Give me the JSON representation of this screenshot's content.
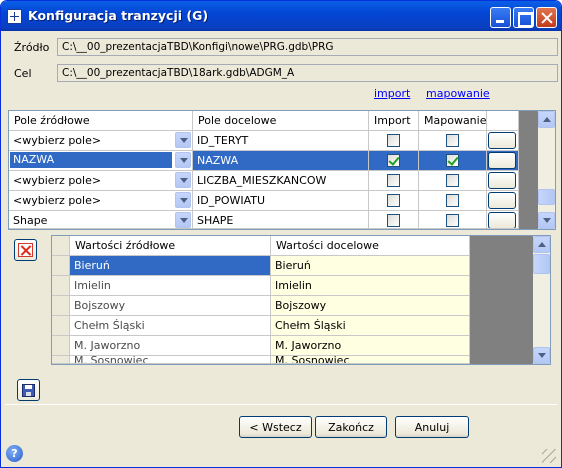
{
  "window": {
    "title": "Konfiguracja tranzycji (G)"
  },
  "source": {
    "label": "Źródło",
    "value": "C:\\__00_prezentacjaTBD\\Konfigi\\nowe\\PRG.gdb\\PRG"
  },
  "target": {
    "label": "Cel",
    "value": "C:\\__00_prezentacjaTBD\\18ark.gdb\\ADGM_A"
  },
  "links": {
    "import": "import",
    "mapping": "mapowanie"
  },
  "fields_grid": {
    "headers": [
      "Pole źródłowe",
      "Pole docelowe",
      "Import",
      "Mapowanie"
    ],
    "rows": [
      {
        "source": "<wybierz pole>",
        "target": "ID_TERYT",
        "import": false,
        "mapping": false,
        "selected": false
      },
      {
        "source": "NAZWA",
        "target": "NAZWA",
        "import": true,
        "mapping": true,
        "selected": true
      },
      {
        "source": "<wybierz pole>",
        "target": "LICZBA_MIESZKANCOW",
        "import": false,
        "mapping": false,
        "selected": false
      },
      {
        "source": "<wybierz pole>",
        "target": "ID_POWIATU",
        "import": false,
        "mapping": false,
        "selected": false
      },
      {
        "source": "Shape",
        "target": "SHAPE",
        "import": false,
        "mapping": false,
        "selected": false
      }
    ]
  },
  "values_grid": {
    "headers": [
      "Wartości źródłowe",
      "Wartości docelowe"
    ],
    "rows": [
      {
        "source": "Bieruń",
        "target": "Bieruń"
      },
      {
        "source": "Imielin",
        "target": "Imielin"
      },
      {
        "source": "Bojszowy",
        "target": "Bojszowy"
      },
      {
        "source": "Chełm Śląski",
        "target": "Chełm Śląski"
      },
      {
        "source": "M. Jaworzno",
        "target": "M. Jaworzno"
      },
      {
        "source": "M. Sosnowiec",
        "target": "M. Sosnowiec"
      }
    ]
  },
  "buttons": {
    "back": "< Wstecz",
    "finish": "Zakończ",
    "cancel": "Anuluj"
  },
  "status": {
    "help": "?"
  },
  "colors": {
    "selection": "#316ac5",
    "target_column_bg": "#ffffe1",
    "window_bg": "#ece9d8"
  },
  "icons": {
    "delete": "delete-x-icon",
    "save": "save-disk-icon"
  }
}
